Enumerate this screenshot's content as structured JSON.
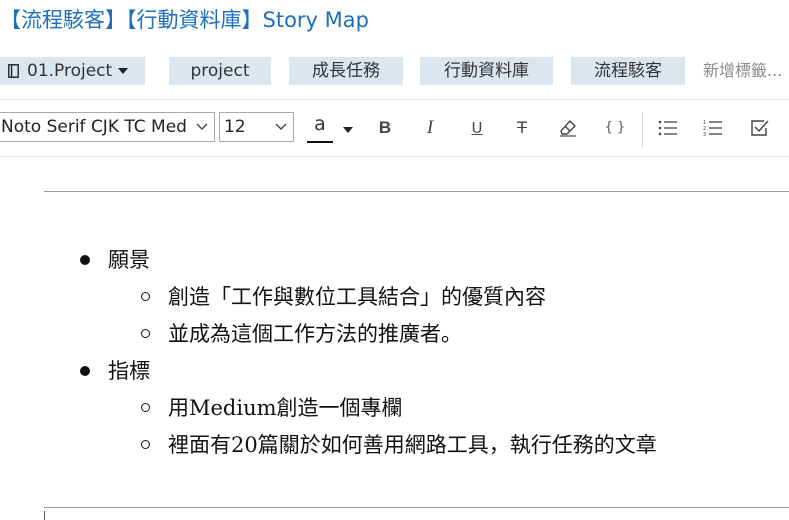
{
  "note_title": "【流程駭客】【行動資料庫】Story Map",
  "tags": {
    "notebook": "01.Project",
    "items": [
      "project",
      "成長任務",
      "行動資料庫",
      "流程駭客"
    ],
    "add_placeholder": "新增標籤..."
  },
  "toolbar": {
    "font_family": "Noto Serif CJK TC Med",
    "font_size": "12",
    "text_color_glyph": "a",
    "bold": "B",
    "italic": "I",
    "underline": "U",
    "strikethrough": "T",
    "code": "{ }",
    "text_color_bar": "#111111"
  },
  "content": {
    "items": [
      {
        "label": "願景",
        "children": [
          "創造「工作與數位工具結合」的優質內容",
          "並成為這個工作方法的推廣者。"
        ]
      },
      {
        "label": "指標",
        "children": [
          "用Medium創造一個專欄",
          "裡面有20篇關於如何善用網路工具，執行任務的文章"
        ]
      }
    ]
  },
  "colors": {
    "title": "#1e6fc0",
    "tag_bg": "#dbe6ee",
    "placeholder": "#8a8a8a"
  }
}
